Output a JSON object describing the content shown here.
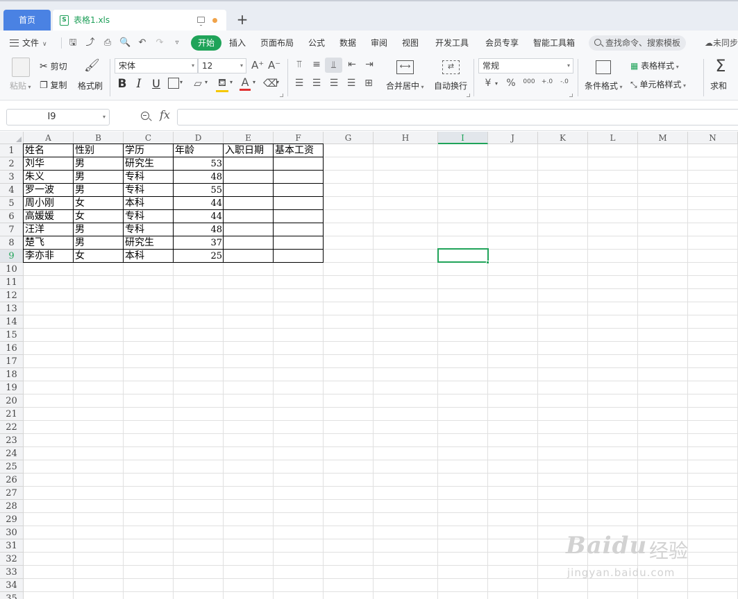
{
  "tabs": {
    "home": "首页",
    "file_name": "表格1.xls",
    "xls_badge": "S",
    "new_tab": "+"
  },
  "menu": {
    "file": "文件",
    "items": [
      "开始",
      "插入",
      "页面布局",
      "公式",
      "数据",
      "审阅",
      "视图",
      "开发工具",
      "会员专享",
      "智能工具箱"
    ],
    "search_placeholder": "查找命令、搜索模板",
    "sync": "未同步"
  },
  "ribbon": {
    "paste": "粘贴",
    "cut": "剪切",
    "copy": "复制",
    "format_painter": "格式刷",
    "font_name": "宋体",
    "font_size": "12",
    "font_grow": "A⁺",
    "font_shrink": "A⁻",
    "bold": "B",
    "italic": "I",
    "underline": "U",
    "font_color_glyph": "A",
    "merge_center": "合并居中",
    "wrap_text": "自动换行",
    "number_format": "常规",
    "currency": "¥",
    "percent": "%",
    "thousands": "000",
    "inc_decimal": "+.0",
    "dec_decimal": "-.0",
    "conditional_format": "条件格式",
    "table_style": "表格样式",
    "cell_style": "单元格样式",
    "sum": "求和",
    "sum_glyph": "Σ"
  },
  "formula_bar": {
    "cell_ref": "I9",
    "fx": "fx",
    "formula": ""
  },
  "sheet": {
    "columns": [
      "A",
      "B",
      "C",
      "D",
      "E",
      "F",
      "G",
      "H",
      "I",
      "J",
      "K",
      "L",
      "M",
      "N"
    ],
    "selected_column": "I",
    "selected_row": 9,
    "row_count": 35,
    "data": [
      [
        "姓名",
        "性别",
        "学历",
        "年龄",
        "入职日期",
        "基本工资"
      ],
      [
        "刘华",
        "男",
        "研究生",
        "53",
        "",
        ""
      ],
      [
        "朱义",
        "男",
        "专科",
        "48",
        "",
        ""
      ],
      [
        "罗一波",
        "男",
        "专科",
        "55",
        "",
        ""
      ],
      [
        "周小刚",
        "女",
        "本科",
        "44",
        "",
        ""
      ],
      [
        "高媛媛",
        "女",
        "专科",
        "44",
        "",
        ""
      ],
      [
        "汪洋",
        "男",
        "专科",
        "48",
        "",
        ""
      ],
      [
        "楚飞",
        "男",
        "研究生",
        "37",
        "",
        ""
      ],
      [
        "李亦非",
        "女",
        "本科",
        "25",
        "",
        ""
      ]
    ]
  },
  "watermark": {
    "brand": "Baidu",
    "brand_cn": "经验",
    "url": "jingyan.baidu.com"
  },
  "colors": {
    "accent_green": "#1fa359",
    "home_tab_blue": "#4a82e3",
    "tab_dot_orange": "#f0a34a"
  }
}
